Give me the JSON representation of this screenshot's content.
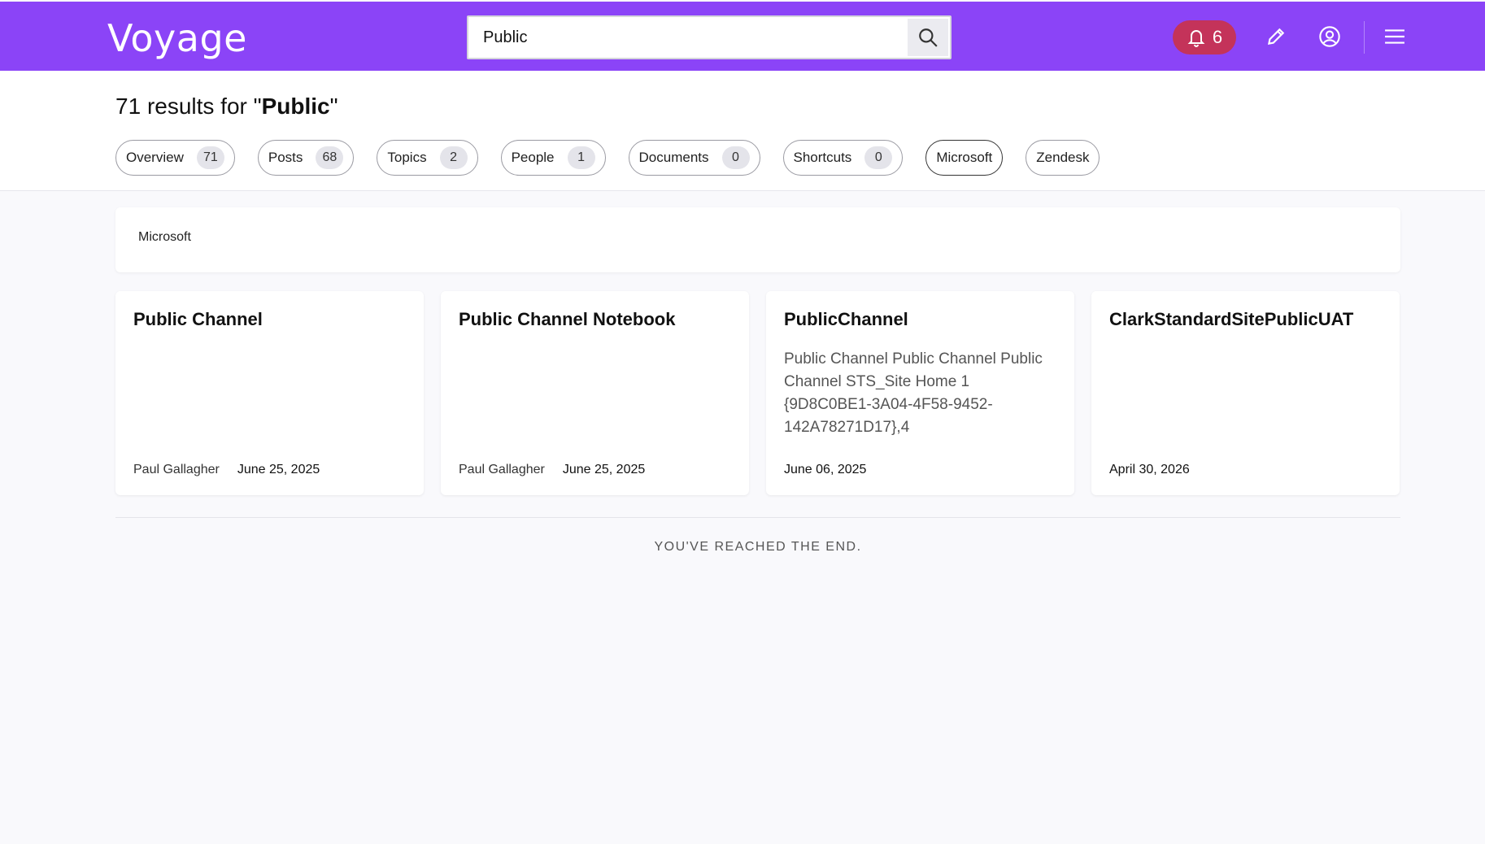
{
  "header": {
    "logo": "Voyage",
    "search_value": "Public",
    "notification_count": "6",
    "colors": {
      "brand": "#8b44f7",
      "notification": "#c4335a"
    }
  },
  "results": {
    "count": "71",
    "prefix": "results for \"",
    "query": "Public",
    "suffix": "\"",
    "chips": [
      {
        "label": "Overview",
        "count": "71"
      },
      {
        "label": "Posts",
        "count": "68"
      },
      {
        "label": "Topics",
        "count": "2"
      },
      {
        "label": "People",
        "count": "1"
      },
      {
        "label": "Documents",
        "count": "0"
      },
      {
        "label": "Shortcuts",
        "count": "0"
      },
      {
        "label": "Microsoft"
      },
      {
        "label": "Zendesk"
      }
    ]
  },
  "filter": {
    "tag": "Microsoft"
  },
  "cards": [
    {
      "title": "Public Channel",
      "desc": "",
      "author": "Paul Gallagher",
      "date": "June 25, 2025"
    },
    {
      "title": "Public Channel Notebook",
      "desc": "",
      "author": "Paul Gallagher",
      "date": "June 25, 2025"
    },
    {
      "title": "PublicChannel",
      "desc": "Public Channel Public Channel Public Channel STS_Site Home 1 {9D8C0BE1-3A04-4F58-9452-142A78271D17},4",
      "author": "",
      "date": "June 06, 2025"
    },
    {
      "title": "ClarkStandardSitePublicUAT",
      "desc": "",
      "author": "",
      "date": "April 30, 2026"
    }
  ],
  "footer": {
    "end_text": "YOU'VE REACHED THE END."
  },
  "icons": [
    "search-icon",
    "bell-icon",
    "pencil-icon",
    "user-circle-icon",
    "menu-icon"
  ]
}
